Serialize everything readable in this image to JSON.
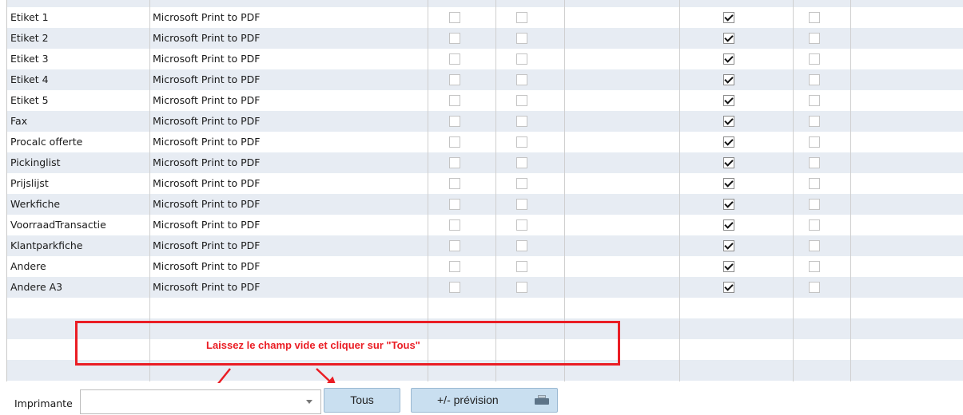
{
  "table": {
    "rows": [
      {
        "name": "Etiket 1",
        "printer": "Microsoft Print to PDF",
        "chk1": false,
        "chk2": false,
        "chk3": true,
        "chk4": false
      },
      {
        "name": "Etiket 2",
        "printer": "Microsoft Print to PDF",
        "chk1": false,
        "chk2": false,
        "chk3": true,
        "chk4": false
      },
      {
        "name": "Etiket 3",
        "printer": "Microsoft Print to PDF",
        "chk1": false,
        "chk2": false,
        "chk3": true,
        "chk4": false
      },
      {
        "name": "Etiket 4",
        "printer": "Microsoft Print to PDF",
        "chk1": false,
        "chk2": false,
        "chk3": true,
        "chk4": false
      },
      {
        "name": "Etiket 5",
        "printer": "Microsoft Print to PDF",
        "chk1": false,
        "chk2": false,
        "chk3": true,
        "chk4": false
      },
      {
        "name": "Fax",
        "printer": "Microsoft Print to PDF",
        "chk1": false,
        "chk2": false,
        "chk3": true,
        "chk4": false
      },
      {
        "name": "Procalc offerte",
        "printer": "Microsoft Print to PDF",
        "chk1": false,
        "chk2": false,
        "chk3": true,
        "chk4": false
      },
      {
        "name": "Pickinglist",
        "printer": "Microsoft Print to PDF",
        "chk1": false,
        "chk2": false,
        "chk3": true,
        "chk4": false
      },
      {
        "name": "Prijslijst",
        "printer": "Microsoft Print to PDF",
        "chk1": false,
        "chk2": false,
        "chk3": true,
        "chk4": false
      },
      {
        "name": "Werkfiche",
        "printer": "Microsoft Print to PDF",
        "chk1": false,
        "chk2": false,
        "chk3": true,
        "chk4": false
      },
      {
        "name": "VoorraadTransactie",
        "printer": "Microsoft Print to PDF",
        "chk1": false,
        "chk2": false,
        "chk3": true,
        "chk4": false
      },
      {
        "name": "Klantparkfiche",
        "printer": "Microsoft Print to PDF",
        "chk1": false,
        "chk2": false,
        "chk3": true,
        "chk4": false
      },
      {
        "name": "Andere",
        "printer": "Microsoft Print to PDF",
        "chk1": false,
        "chk2": false,
        "chk3": true,
        "chk4": false
      },
      {
        "name": "Andere A3",
        "printer": "Microsoft Print to PDF",
        "chk1": false,
        "chk2": false,
        "chk3": true,
        "chk4": false
      }
    ],
    "empty_rows": 5
  },
  "annotation": {
    "text": "Laissez le champ vide et cliquer sur \"Tous\"",
    "color": "#ea1d24"
  },
  "footer": {
    "printer_label": "Imprimante",
    "printer_value": "",
    "all_button": "Tous",
    "preview_button": "+/-  prévision",
    "preview_icon": "printer-icon"
  },
  "colors": {
    "row_alt": "#e7ecf3",
    "button_bg": "#c9dff0",
    "annotation": "#ea1d24"
  }
}
